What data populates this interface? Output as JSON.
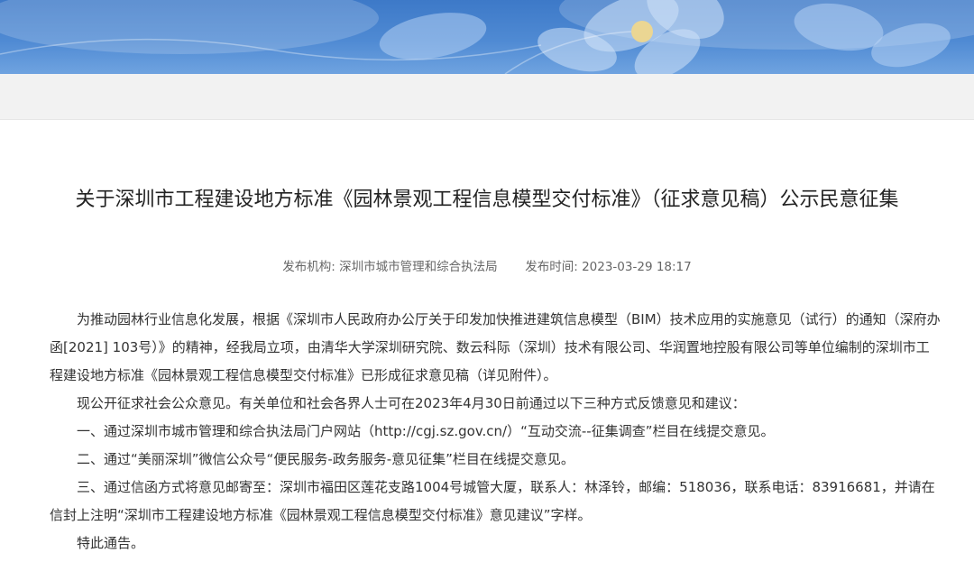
{
  "article": {
    "title": "关于深圳市工程建设地方标准《园林景观工程信息模型交付标准》（征求意见稿）公示民意征集",
    "publisher_label": "发布机构:",
    "publisher": "深圳市城市管理和综合执法局",
    "time_label": "发布时间:",
    "time": "2023-03-29 18:17",
    "paragraphs": [
      "为推动园林行业信息化发展，根据《深圳市人民政府办公厅关于印发加快推进建筑信息模型（BIM）技术应用的实施意见（试行）的通知（深府办函[2021] 103号）》的精神，经我局立项，由清华大学深圳研究院、数云科际（深圳）技术有限公司、华润置地控股有限公司等单位编制的深圳市工程建设地方标准《园林景观工程信息模型交付标准》已形成征求意见稿（详见附件）。",
      "现公开征求社会公众意见。有关单位和社会各界人士可在2023年4月30日前通过以下三种方式反馈意见和建议：",
      "一、通过深圳市城市管理和综合执法局门户网站（http://cgj.sz.gov.cn/）“互动交流--征集调查”栏目在线提交意见。",
      "二、通过“美丽深圳”微信公众号“便民服务-政务服务-意见征集”栏目在线提交意见。",
      "三、通过信函方式将意见邮寄至：深圳市福田区莲花支路1004号城管大厦，联系人：林泽铃，邮编：518036，联系电话：83916681，并请在信封上注明“深圳市工程建设地方标准《园林景观工程信息模型交付标准》意见建议”字样。",
      "特此通告。"
    ]
  }
}
